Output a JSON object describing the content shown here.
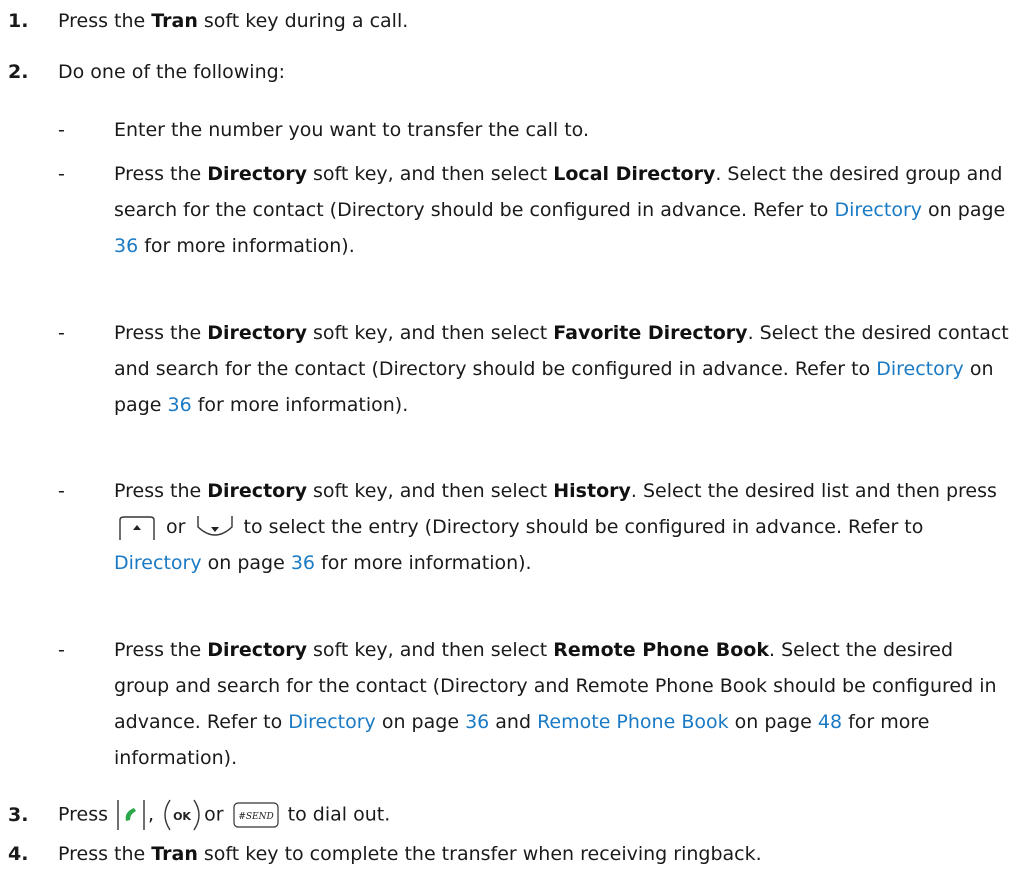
{
  "steps": [
    {
      "num": "1.",
      "pre": "Press the ",
      "bold": "Tran",
      "post": " soft key during a call."
    },
    {
      "num": "2.",
      "text": "Do one of the following:"
    },
    {
      "num": "3.",
      "pre": "Press ",
      "sep1": ",",
      "sep2": "or",
      "post": "to dial out."
    },
    {
      "num": "4.",
      "pre": "Press the ",
      "bold": "Tran",
      "post": " soft key to complete the transfer when receiving ringback."
    }
  ],
  "dash": "-",
  "options": {
    "opt1": {
      "text": "Enter the number you want to transfer the call to."
    },
    "opt2": {
      "p1": "Press the ",
      "b1": "Directory",
      "p2": " soft key, and then select ",
      "b2": "Local Directory",
      "p3": ". Select the desired group and search for the contact (Directory should be configured in advance. Refer to ",
      "link": "Directory",
      "p4": " on page ",
      "page": "36",
      "p5": " for more information)."
    },
    "opt3": {
      "p1": "Press the ",
      "b1": "Directory",
      "p2": " soft key, and then select ",
      "b2": "Favorite Directory",
      "p3": ". Select the desired contact and search for the contact (Directory should be configured in advance. Refer to ",
      "link": "Directory",
      "p4": " on page ",
      "page": "36",
      "p5": " for more information)."
    },
    "opt4": {
      "p1": "Press the ",
      "b1": "Directory",
      "p2": " soft key, and then select ",
      "b2": "History",
      "p3": ". Select the desired list and then press ",
      "or": " or ",
      "p4": " to select the entry (Directory should be configured in advance. Refer to ",
      "link": "Directory",
      "p5": " on page ",
      "page": "36",
      "p6": " for more information)."
    },
    "opt5": {
      "p1": "Press the ",
      "b1": "Directory",
      "p2": " soft key, and then select ",
      "b2": "Remote Phone Book",
      "p3": ". Select the desired group and search for the contact (Directory and Remote Phone Book should be configured in advance. Refer to ",
      "link1": "Directory",
      "p4": " on page ",
      "page1": "36",
      "p5": " and ",
      "link2": "Remote Phone Book",
      "p6": " on page ",
      "page2": "48",
      "p7": " for more information)."
    }
  },
  "keys": {
    "up": "up-arrow-key-icon",
    "down": "down-arrow-key-icon",
    "call": "handset-call-key-icon",
    "ok_label": "OK",
    "send_label": "#SEND"
  },
  "colors": {
    "link": "#1a7ac4",
    "text": "#1a1a1a",
    "call_green": "#2aa84a"
  }
}
